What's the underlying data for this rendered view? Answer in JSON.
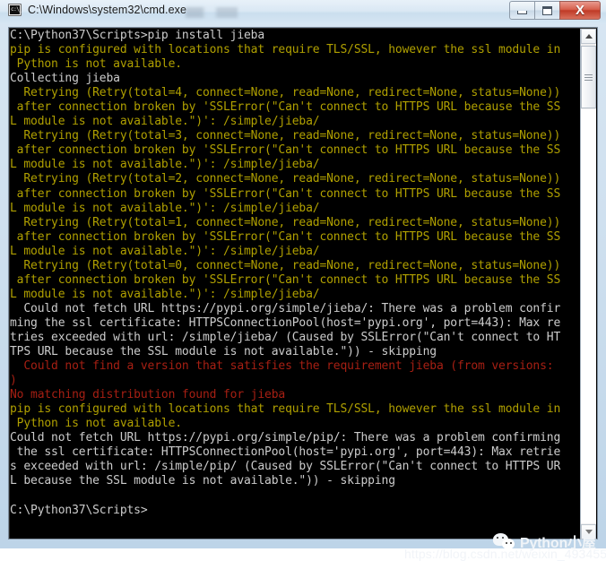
{
  "window": {
    "title": "C:\\Windows\\system32\\cmd.exe",
    "icon": "cmd-icon",
    "buttons": {
      "minimize": "minimize",
      "maximize": "maximize",
      "close": "X"
    }
  },
  "colors": {
    "console_background": "#000000",
    "text_default": "#cccccc",
    "text_warning": "#b0a000",
    "text_error": "#a61f13",
    "titlebar": "#d6e6f3",
    "close_button": "#bf3a26"
  },
  "scrollbar": {
    "up_arrow": "scroll-up-arrow",
    "down_arrow": "scroll-down-arrow",
    "thumb": "scroll-thumb"
  },
  "console": {
    "prompt": "C:\\Python37\\Scripts>",
    "command": "pip install jieba",
    "lines": [
      {
        "text": "C:\\Python37\\Scripts>pip install jieba",
        "color": "white"
      },
      {
        "text": "pip is configured with locations that require TLS/SSL, however the ssl module in",
        "color": "yellow"
      },
      {
        "text": " Python is not available.",
        "color": "yellow"
      },
      {
        "text": "Collecting jieba",
        "color": "white"
      },
      {
        "text": "  Retrying (Retry(total=4, connect=None, read=None, redirect=None, status=None))",
        "color": "yellow"
      },
      {
        "text": " after connection broken by 'SSLError(\"Can't connect to HTTPS URL because the SS",
        "color": "yellow"
      },
      {
        "text": "L module is not available.\")': /simple/jieba/",
        "color": "yellow"
      },
      {
        "text": "  Retrying (Retry(total=3, connect=None, read=None, redirect=None, status=None))",
        "color": "yellow"
      },
      {
        "text": " after connection broken by 'SSLError(\"Can't connect to HTTPS URL because the SS",
        "color": "yellow"
      },
      {
        "text": "L module is not available.\")': /simple/jieba/",
        "color": "yellow"
      },
      {
        "text": "  Retrying (Retry(total=2, connect=None, read=None, redirect=None, status=None))",
        "color": "yellow"
      },
      {
        "text": " after connection broken by 'SSLError(\"Can't connect to HTTPS URL because the SS",
        "color": "yellow"
      },
      {
        "text": "L module is not available.\")': /simple/jieba/",
        "color": "yellow"
      },
      {
        "text": "  Retrying (Retry(total=1, connect=None, read=None, redirect=None, status=None))",
        "color": "yellow"
      },
      {
        "text": " after connection broken by 'SSLError(\"Can't connect to HTTPS URL because the SS",
        "color": "yellow"
      },
      {
        "text": "L module is not available.\")': /simple/jieba/",
        "color": "yellow"
      },
      {
        "text": "  Retrying (Retry(total=0, connect=None, read=None, redirect=None, status=None))",
        "color": "yellow"
      },
      {
        "text": " after connection broken by 'SSLError(\"Can't connect to HTTPS URL because the SS",
        "color": "yellow"
      },
      {
        "text": "L module is not available.\")': /simple/jieba/",
        "color": "yellow"
      },
      {
        "text": "  Could not fetch URL https://pypi.org/simple/jieba/: There was a problem confir",
        "color": "white"
      },
      {
        "text": "ming the ssl certificate: HTTPSConnectionPool(host='pypi.org', port=443): Max re",
        "color": "white"
      },
      {
        "text": "tries exceeded with url: /simple/jieba/ (Caused by SSLError(\"Can't connect to HT",
        "color": "white"
      },
      {
        "text": "TPS URL because the SSL module is not available.\")) - skipping",
        "color": "white"
      },
      {
        "text": "  Could not find a version that satisfies the requirement jieba (from versions:",
        "color": "red"
      },
      {
        "text": ")",
        "color": "red"
      },
      {
        "text": "No matching distribution found for jieba",
        "color": "red"
      },
      {
        "text": "pip is configured with locations that require TLS/SSL, however the ssl module in",
        "color": "yellow"
      },
      {
        "text": " Python is not available.",
        "color": "yellow"
      },
      {
        "text": "Could not fetch URL https://pypi.org/simple/pip/: There was a problem confirming",
        "color": "white"
      },
      {
        "text": " the ssl certificate: HTTPSConnectionPool(host='pypi.org', port=443): Max retrie",
        "color": "white"
      },
      {
        "text": "s exceeded with url: /simple/pip/ (Caused by SSLError(\"Can't connect to HTTPS UR",
        "color": "white"
      },
      {
        "text": "L because the SSL module is not available.\")) - skipping",
        "color": "white"
      },
      {
        "text": "",
        "color": "white"
      },
      {
        "text": "C:\\Python37\\Scripts>",
        "color": "white"
      }
    ]
  },
  "watermark": {
    "url": "https://blog.csdn.net/weixin_493455",
    "brand": "Python小屋",
    "brand_icon": "wechat-icon"
  }
}
